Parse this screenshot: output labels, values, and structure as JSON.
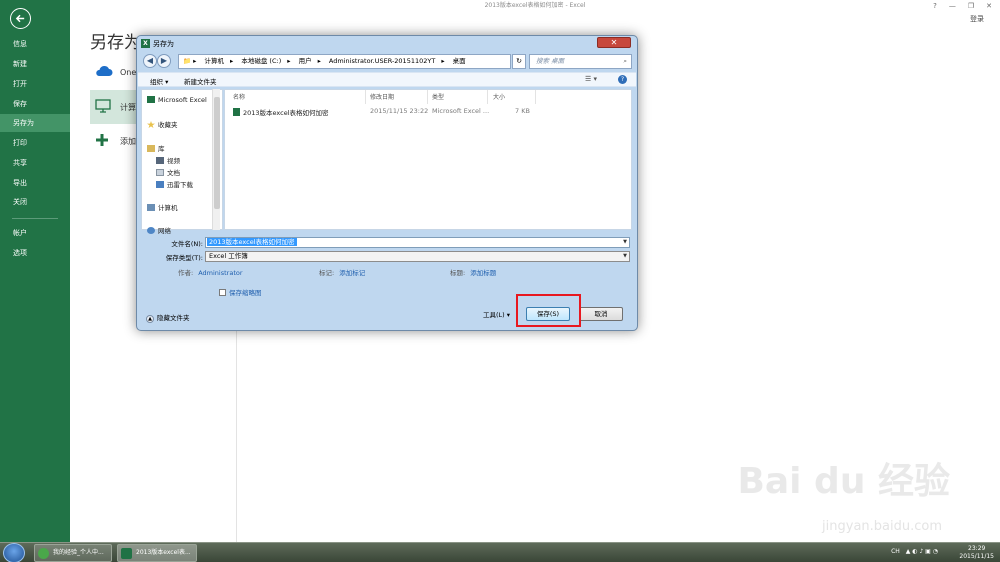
{
  "window": {
    "title": "2013版本excel表格如何加密 - Excel",
    "help": "?",
    "minimize": "—",
    "restore": "❐",
    "close": "✕",
    "login": "登录"
  },
  "sidebar": {
    "items": [
      {
        "label": "信息"
      },
      {
        "label": "新建"
      },
      {
        "label": "打开"
      },
      {
        "label": "保存"
      },
      {
        "label": "另存为",
        "active": true
      },
      {
        "label": "打印"
      },
      {
        "label": "共享"
      },
      {
        "label": "导出"
      },
      {
        "label": "关闭"
      },
      {
        "label": "帐户"
      },
      {
        "label": "选项"
      }
    ]
  },
  "backstage": {
    "title": "另存为",
    "places": [
      {
        "label": "OneDrive"
      },
      {
        "label": "计算机"
      },
      {
        "label": "添加位置"
      }
    ]
  },
  "dialog": {
    "title": "另存为",
    "address": [
      "计算机",
      "本地磁盘 (C:)",
      "用户",
      "Administrator.USER-20151102YT",
      "桌面"
    ],
    "search_placeholder": "搜索 桌面",
    "toolbar": {
      "organize": "组织 ▾",
      "new_folder": "新建文件夹"
    },
    "nav": [
      {
        "label": "Microsoft Excel"
      },
      {
        "label": "收藏夹"
      },
      {
        "label": "库"
      },
      {
        "label": "视频"
      },
      {
        "label": "文档"
      },
      {
        "label": "迅雷下载"
      },
      {
        "label": "计算机"
      },
      {
        "label": "网络"
      }
    ],
    "columns": [
      "名称",
      "修改日期",
      "类型",
      "大小"
    ],
    "files": [
      {
        "name": "2013版本excel表格如何加密",
        "date": "2015/11/15 23:22",
        "type": "Microsoft Excel ...",
        "size": "7 KB"
      }
    ],
    "filename_label": "文件名(N):",
    "filename_value": "2013版本excel表格如何加密",
    "filetype_label": "保存类型(T):",
    "filetype_value": "Excel 工作簿",
    "author_label": "作者:",
    "author_value": "Administrator",
    "tags_label": "标记:",
    "tags_value": "添加标记",
    "title_label": "标题:",
    "title_value": "添加标题",
    "thumbnail_label": "保存缩略图",
    "hide_folders": "隐藏文件夹",
    "tools": "工具(L)",
    "save": "保存(S)",
    "cancel": "取消"
  },
  "taskbar": {
    "tasks": [
      {
        "label": "我的经验_个人中..."
      },
      {
        "label": "2013版本excel表..."
      }
    ],
    "tray": "CH",
    "time": "23:29",
    "date": "2015/11/15"
  },
  "watermark": {
    "main": "Bai du 经验",
    "sub": "jingyan.baidu.com"
  }
}
